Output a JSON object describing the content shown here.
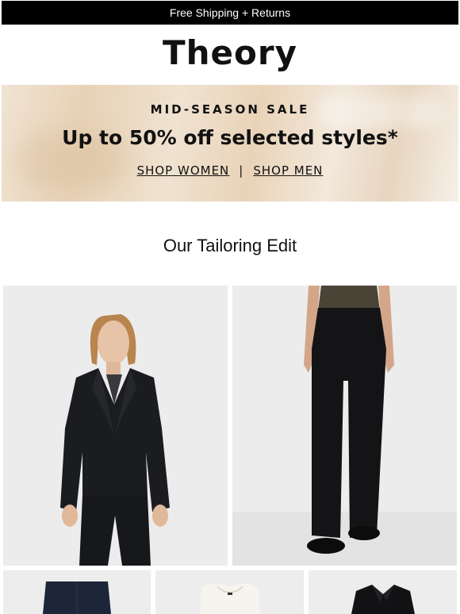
{
  "topbar": {
    "text": "Free Shipping + Returns"
  },
  "brand": {
    "logo": "Theory"
  },
  "banner": {
    "eyebrow": "MID-SEASON SALE",
    "headline": "Up to 50% off selected styles*",
    "link_women": "SHOP WOMEN",
    "separator": "|",
    "link_men": "SHOP MEN"
  },
  "section": {
    "title": "Our Tailoring Edit"
  },
  "colors": {
    "topbar_bg": "#000000",
    "text": "#111111",
    "photo_bg": "#ececec"
  }
}
